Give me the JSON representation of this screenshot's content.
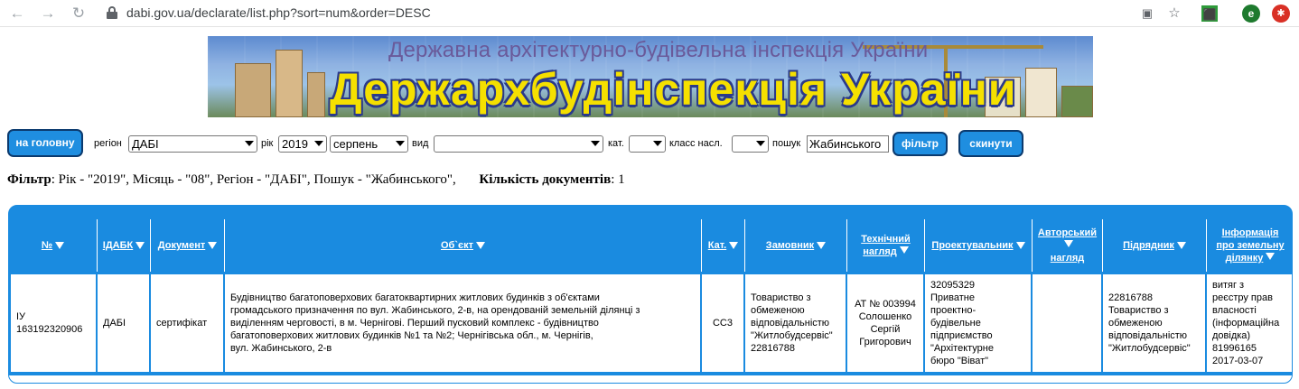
{
  "browser": {
    "url": "dabi.gov.ua/declarate/list.php?sort=num&order=DESC",
    "profile_initial": "e"
  },
  "banner": {
    "top_title": "Державна архітектурно-будівельна інспекція України",
    "main_title": "Держархбудінспекція України"
  },
  "toolbar": {
    "home_label": "на головну",
    "region_label": "регіон",
    "region_value": "ДАБІ",
    "year_label": "рік",
    "year_value": "2019",
    "month_value": "серпень",
    "type_label": "вид",
    "type_value": "",
    "cat_label": "кат.",
    "cat_value": "",
    "class_label": "класс насл.",
    "class_value": "",
    "search_label": "пошук",
    "search_value": "Жабинського",
    "filter_label": "фільтр",
    "reset_label": "скинути"
  },
  "filter_summary": {
    "filter_label": "Фільтр",
    "filter_text": ": Рік - \"2019\", Місяць - \"08\", Регіон - \"ДАБІ\", Пошук - \"Жабинського\",",
    "count_label": "Кількість документів",
    "count_text": ": 1"
  },
  "table": {
    "headers": {
      "num": "№",
      "idabk": "ІДАБК",
      "document": "Документ",
      "object": "Об`єкт",
      "cat": "Кат.",
      "customer": "Замовник",
      "tech_supervision_1": "Технічний",
      "tech_supervision_2": "нагляд",
      "designer": "Проектувальник",
      "author_supervision_1": "Авторський",
      "author_supervision_2": "нагляд",
      "contractor": "Підрядник",
      "land_info_1": "Інформація",
      "land_info_2": "про земельну",
      "land_info_3": "ділянку"
    },
    "row": {
      "num_1": "ІУ",
      "num_2": "163192320906",
      "idabk": "ДАБІ",
      "document": "сертифікат",
      "object_1": "Будівництво багатоповерхових багатоквартирних житлових будинків з об'єктами",
      "object_2": "громадського призначення по вул. Жабинського, 2-в, на орендованій земельній ділянці з",
      "object_3": "виділенням черговості, в м. Чернігові. Перший пусковий комплекс - будівництво",
      "object_4": "багатоповерхових житлових будинків №1 та №2; Чернігівська обл., м. Чернігів,",
      "object_5": "вул. Жабинського, 2-в",
      "cat": "СС3",
      "customer_1": "Товариство з",
      "customer_2": "обмеженою",
      "customer_3": "відповідальністю",
      "customer_4": "\"Житлобудсервіс\"",
      "customer_5": "22816788",
      "tech_1": "АТ № 003994",
      "tech_2": "Солошенко",
      "tech_3": "Сергій",
      "tech_4": "Григорович",
      "designer_1": "32095329",
      "designer_2": "Приватне",
      "designer_3": "проектно-",
      "designer_4": "будівельне",
      "designer_5": "підприємство",
      "designer_6": "\"Архітектурне",
      "designer_7": "бюро \"Віват\"",
      "author": "",
      "contractor_1": "22816788",
      "contractor_2": "Товариство з",
      "contractor_3": "обмеженою",
      "contractor_4": "відповідальністю",
      "contractor_5": "\"Житлобудсервіс\"",
      "land_1": "витяг з",
      "land_2": "реєстру прав",
      "land_3": "власності",
      "land_4": "(інформаційна",
      "land_5": "довідка)",
      "land_6": "81996165",
      "land_7": "2017-03-07"
    }
  },
  "colors": {
    "accent": "#1a8be0",
    "button": "#1f8ee0",
    "button_border": "#0b3a6e",
    "banner_title": "#f5e000"
  }
}
